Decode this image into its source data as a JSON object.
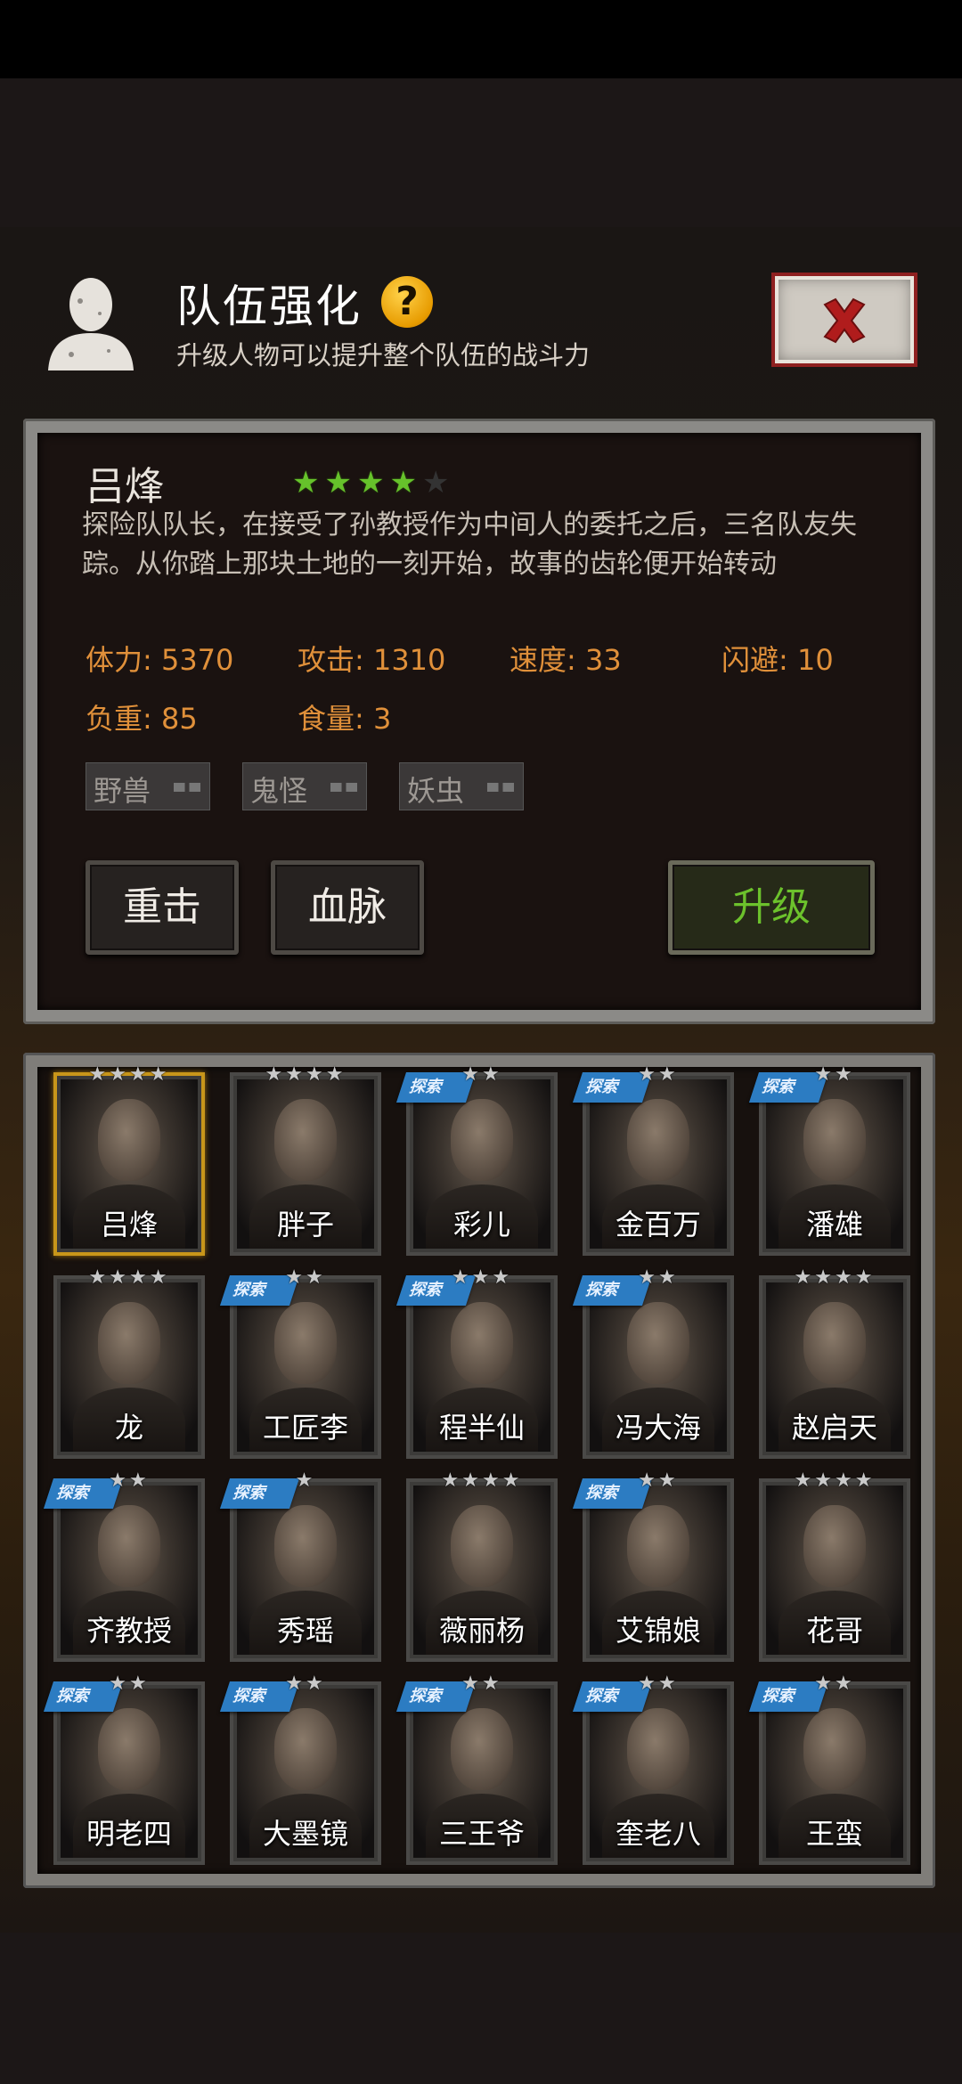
{
  "header": {
    "title": "队伍强化",
    "subtitle": "升级人物可以提升整个队伍的战斗力",
    "help_glyph": "?"
  },
  "hero": {
    "name": "吕烽",
    "stars_filled": 4,
    "stars_total": 5,
    "description": "探险队队长，在接受了孙教授作为中间人的委托之后，三名队友失踪。从你踏上那块土地的一刻开始，故事的齿轮便开始转动",
    "stats": {
      "hp": "体力: 5370",
      "attack": "攻击: 1310",
      "speed": "速度: 33",
      "dodge": "闪避: 10",
      "load": "负重: 85",
      "food": "食量: 3"
    },
    "tags": [
      "野兽",
      "鬼怪",
      "妖虫"
    ]
  },
  "actions": {
    "heavy_strike": "重击",
    "bloodline": "血脉",
    "upgrade": "升级"
  },
  "ribbon_label": "探索",
  "colors": {
    "stat_text": "#e0903a",
    "star_active": "#66c22b",
    "upgrade_text": "#6cc22c",
    "selected_border": "#c8961a",
    "ribbon": "#2c7cc2",
    "close_x": "#b01c1c"
  },
  "roster": [
    {
      "name": "吕烽",
      "stars": "★★★★",
      "ribbon": false,
      "selected": true
    },
    {
      "name": "胖子",
      "stars": "★★★★",
      "ribbon": false,
      "selected": false
    },
    {
      "name": "彩儿",
      "stars": "★★",
      "ribbon": true,
      "selected": false
    },
    {
      "name": "金百万",
      "stars": "★★",
      "ribbon": true,
      "selected": false
    },
    {
      "name": "潘雄",
      "stars": "★★",
      "ribbon": true,
      "selected": false
    },
    {
      "name": "龙",
      "stars": "★★★★",
      "ribbon": false,
      "selected": false
    },
    {
      "name": "工匠李",
      "stars": "★★",
      "ribbon": true,
      "selected": false
    },
    {
      "name": "程半仙",
      "stars": "★★★",
      "ribbon": true,
      "selected": false
    },
    {
      "name": "冯大海",
      "stars": "★★",
      "ribbon": true,
      "selected": false
    },
    {
      "name": "赵启天",
      "stars": "★★★★",
      "ribbon": false,
      "selected": false
    },
    {
      "name": "齐教授",
      "stars": "★★",
      "ribbon": true,
      "selected": false
    },
    {
      "name": "秀瑶",
      "stars": "★",
      "ribbon": true,
      "selected": false
    },
    {
      "name": "薇丽杨",
      "stars": "★★★★",
      "ribbon": false,
      "selected": false
    },
    {
      "name": "艾锦娘",
      "stars": "★★",
      "ribbon": true,
      "selected": false
    },
    {
      "name": "花哥",
      "stars": "★★★★",
      "ribbon": false,
      "selected": false
    },
    {
      "name": "明老四",
      "stars": "★★",
      "ribbon": true,
      "selected": false
    },
    {
      "name": "大墨镜",
      "stars": "★★",
      "ribbon": true,
      "selected": false
    },
    {
      "name": "三王爷",
      "stars": "★★",
      "ribbon": true,
      "selected": false
    },
    {
      "name": "奎老八",
      "stars": "★★",
      "ribbon": true,
      "selected": false
    },
    {
      "name": "王蛮",
      "stars": "★★",
      "ribbon": true,
      "selected": false
    }
  ]
}
